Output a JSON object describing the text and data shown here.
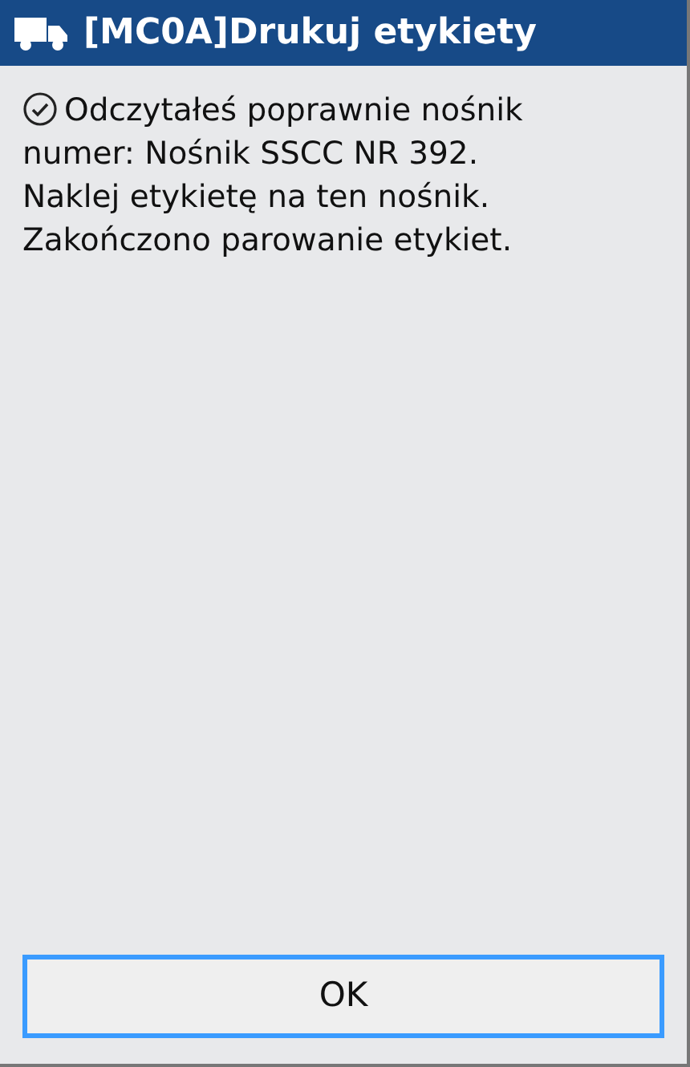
{
  "window": {
    "title": "[MC0A]Drukuj etykiety"
  },
  "message": {
    "lines": [
      "Odczytałeś poprawnie nośnik",
      "numer: Nośnik SSCC NR 392.",
      "Naklej etykietę na ten nośnik.",
      "Zakończono parowanie etykiet."
    ]
  },
  "buttons": [
    {
      "label": "OK",
      "focused": true
    }
  ]
}
